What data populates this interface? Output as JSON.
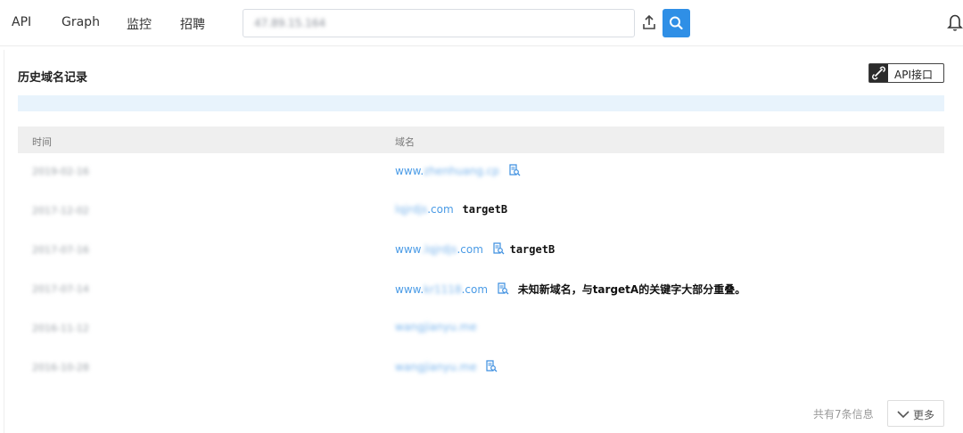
{
  "nav": {
    "items": [
      "API",
      "Graph",
      "监控",
      "招聘"
    ]
  },
  "search": {
    "value": "47.89.15.164"
  },
  "icons": {
    "upload": "upload-icon",
    "search": "search-icon",
    "bell": "bell-icon",
    "link": "link-icon",
    "document": "document-search-icon",
    "chevron": "chevron-down-icon"
  },
  "colors": {
    "accent": "#2f8fe6",
    "link": "#4a9be6",
    "strip": "#e8f3fc",
    "header_bg": "#efefef"
  },
  "card": {
    "title": "历史域名记录",
    "api_button": "API接口"
  },
  "table": {
    "columns": [
      "时间",
      "域名"
    ],
    "rows": [
      {
        "date": "2019-02-16",
        "prefix": "www.",
        "blurred": "zhenhuang.cp",
        "suffix": "",
        "has_icon": true,
        "note": ""
      },
      {
        "date": "2017-12-02",
        "prefix": "",
        "blurred": "lqjrdjs",
        "suffix": ".com",
        "has_icon": false,
        "note": "targetB"
      },
      {
        "date": "2017-07-16",
        "prefix": "www",
        "blurred": ".lqjrdjs",
        "suffix": ".com",
        "has_icon": true,
        "note": "targetB"
      },
      {
        "date": "2017-07-14",
        "prefix": "www.",
        "blurred": "kr1118",
        "suffix": ".com",
        "has_icon": true,
        "note": "未知新域名，与targetA的关键字大部分重叠。"
      },
      {
        "date": "2016-11-12",
        "prefix": "",
        "blurred": "wangjianyu.me",
        "suffix": "",
        "has_icon": false,
        "note": ""
      },
      {
        "date": "2016-10-28",
        "prefix": "",
        "blurred": "wangjianyu.me",
        "suffix": "",
        "has_icon": true,
        "note": ""
      }
    ]
  },
  "footer": {
    "count_text": "共有7条信息",
    "more_label": "更多"
  }
}
